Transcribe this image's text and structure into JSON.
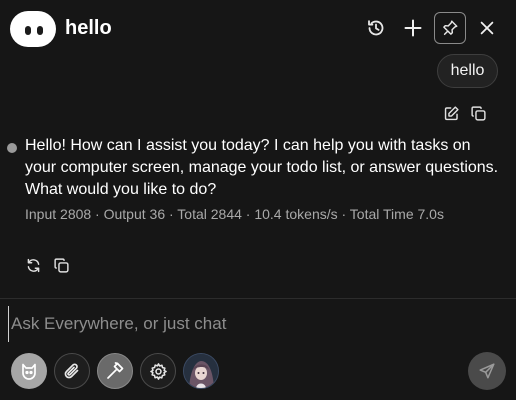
{
  "header": {
    "title": "hello",
    "buttons": {
      "history": "history-icon",
      "new_chat": "plus-icon",
      "pin": "pin-icon",
      "close": "close-icon"
    }
  },
  "conversation": {
    "user_message": "hello",
    "assistant_message": "Hello! How can I assist you today? I can help you with tasks on your computer screen, manage your todo list, or answer questions. What would you like to do?",
    "stats": "Input 2808 · Output 36 · Total 2844 · 10.4 tokens/s · Total Time 7.0s"
  },
  "input": {
    "value": "",
    "placeholder": "Ask Everywhere, or just chat"
  },
  "toolbar": {
    "items": [
      "cat-mode-icon",
      "paperclip-icon",
      "hammer-icon",
      "gear-icon",
      "avatar",
      "send-icon"
    ]
  },
  "colors": {
    "background": "#161616",
    "text": "#ffffff",
    "muted": "#a9a9a9",
    "bubble": "#222222"
  }
}
